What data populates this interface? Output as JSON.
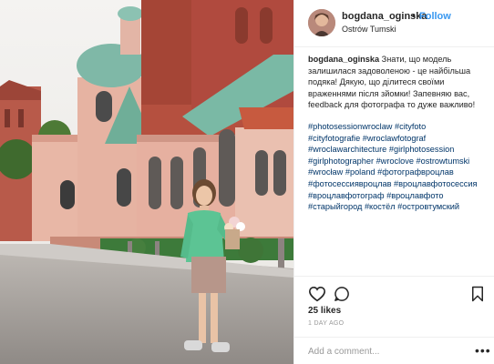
{
  "post": {
    "username": "bogdana_oginska",
    "separator": "•",
    "follow_label": "Follow",
    "location": "Ostrów Tumski",
    "caption_username": "bogdana_oginska",
    "caption_lines": [
      " Знати, що модель",
      "залишилася задоволеною - це найбільша",
      "подяка! Дякую, що ділитеся своїми",
      "враженнями після зйомки! Запевняю вас,",
      "feedback для фотографа то дуже важливо!"
    ],
    "hashtag_lines": [
      "#photosessionwroclaw #cityfoto",
      "#cityfotografie #wroclawfotograf",
      "#wroclawarchitecture #girlphotosession",
      "#girlphotographer #wroclove #ostrowtumski",
      "#wrocław #poland #фотографвроцлав",
      "#фотосессиявроцлав #вроцлавфотосессия",
      "#вроцлавфотограф #вроцлавфото",
      "#старыйгород #костёл #островтумский"
    ],
    "likes": "25 likes",
    "time_ago": "1 DAY AGO",
    "comment_placeholder": "Add a comment...",
    "more_label": "•••"
  },
  "icons": {
    "like": "heart-outline-icon",
    "comment": "speech-bubble-icon",
    "save": "bookmark-icon"
  },
  "colors": {
    "link": "#3897f0",
    "hashtag": "#003569",
    "sweater": "#4fc48f",
    "brick": "#b04a3e"
  }
}
